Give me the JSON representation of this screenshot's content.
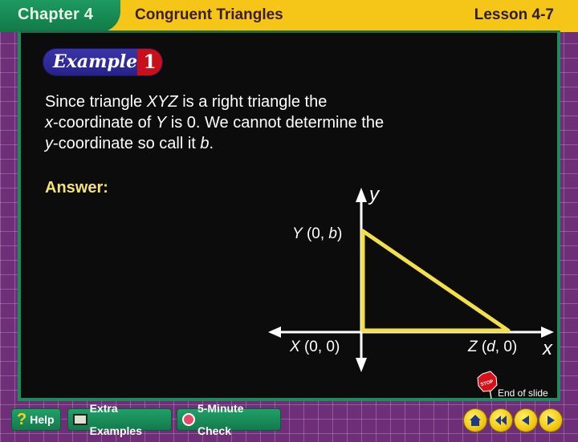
{
  "header": {
    "chapter": "Chapter 4",
    "title": "Congruent Triangles",
    "lesson": "Lesson 4-7"
  },
  "example": {
    "word": "Example",
    "number": "1"
  },
  "body": {
    "line1_a": "Since triangle ",
    "line1_b": "XYZ",
    "line1_c": " is a right triangle the",
    "line2_a": "x",
    "line2_b": "-coordinate of ",
    "line2_c": "Y",
    "line2_d": " is 0. We cannot determine the",
    "line3_a": "y",
    "line3_b": "-coordinate so call it ",
    "line3_c": "b",
    "line3_d": "."
  },
  "answer_label": "Answer:",
  "graph": {
    "y_axis_label": "y",
    "x_axis_label": "x",
    "points": {
      "Y": {
        "name": "Y",
        "coords": " (0, ",
        "var": "b",
        "close": ")"
      },
      "X": {
        "name": "X",
        "coords": " (0, 0)"
      },
      "Z": {
        "name": "Z",
        "coords_open": " (",
        "var": "d",
        "coords_close": ", 0)"
      }
    },
    "triangle_color": "#f2e04a"
  },
  "end_of_slide": "End of slide",
  "bottom_buttons": {
    "help": "Help",
    "extra_examples": "Extra Examples",
    "five_minute_check": "5-Minute Check"
  }
}
